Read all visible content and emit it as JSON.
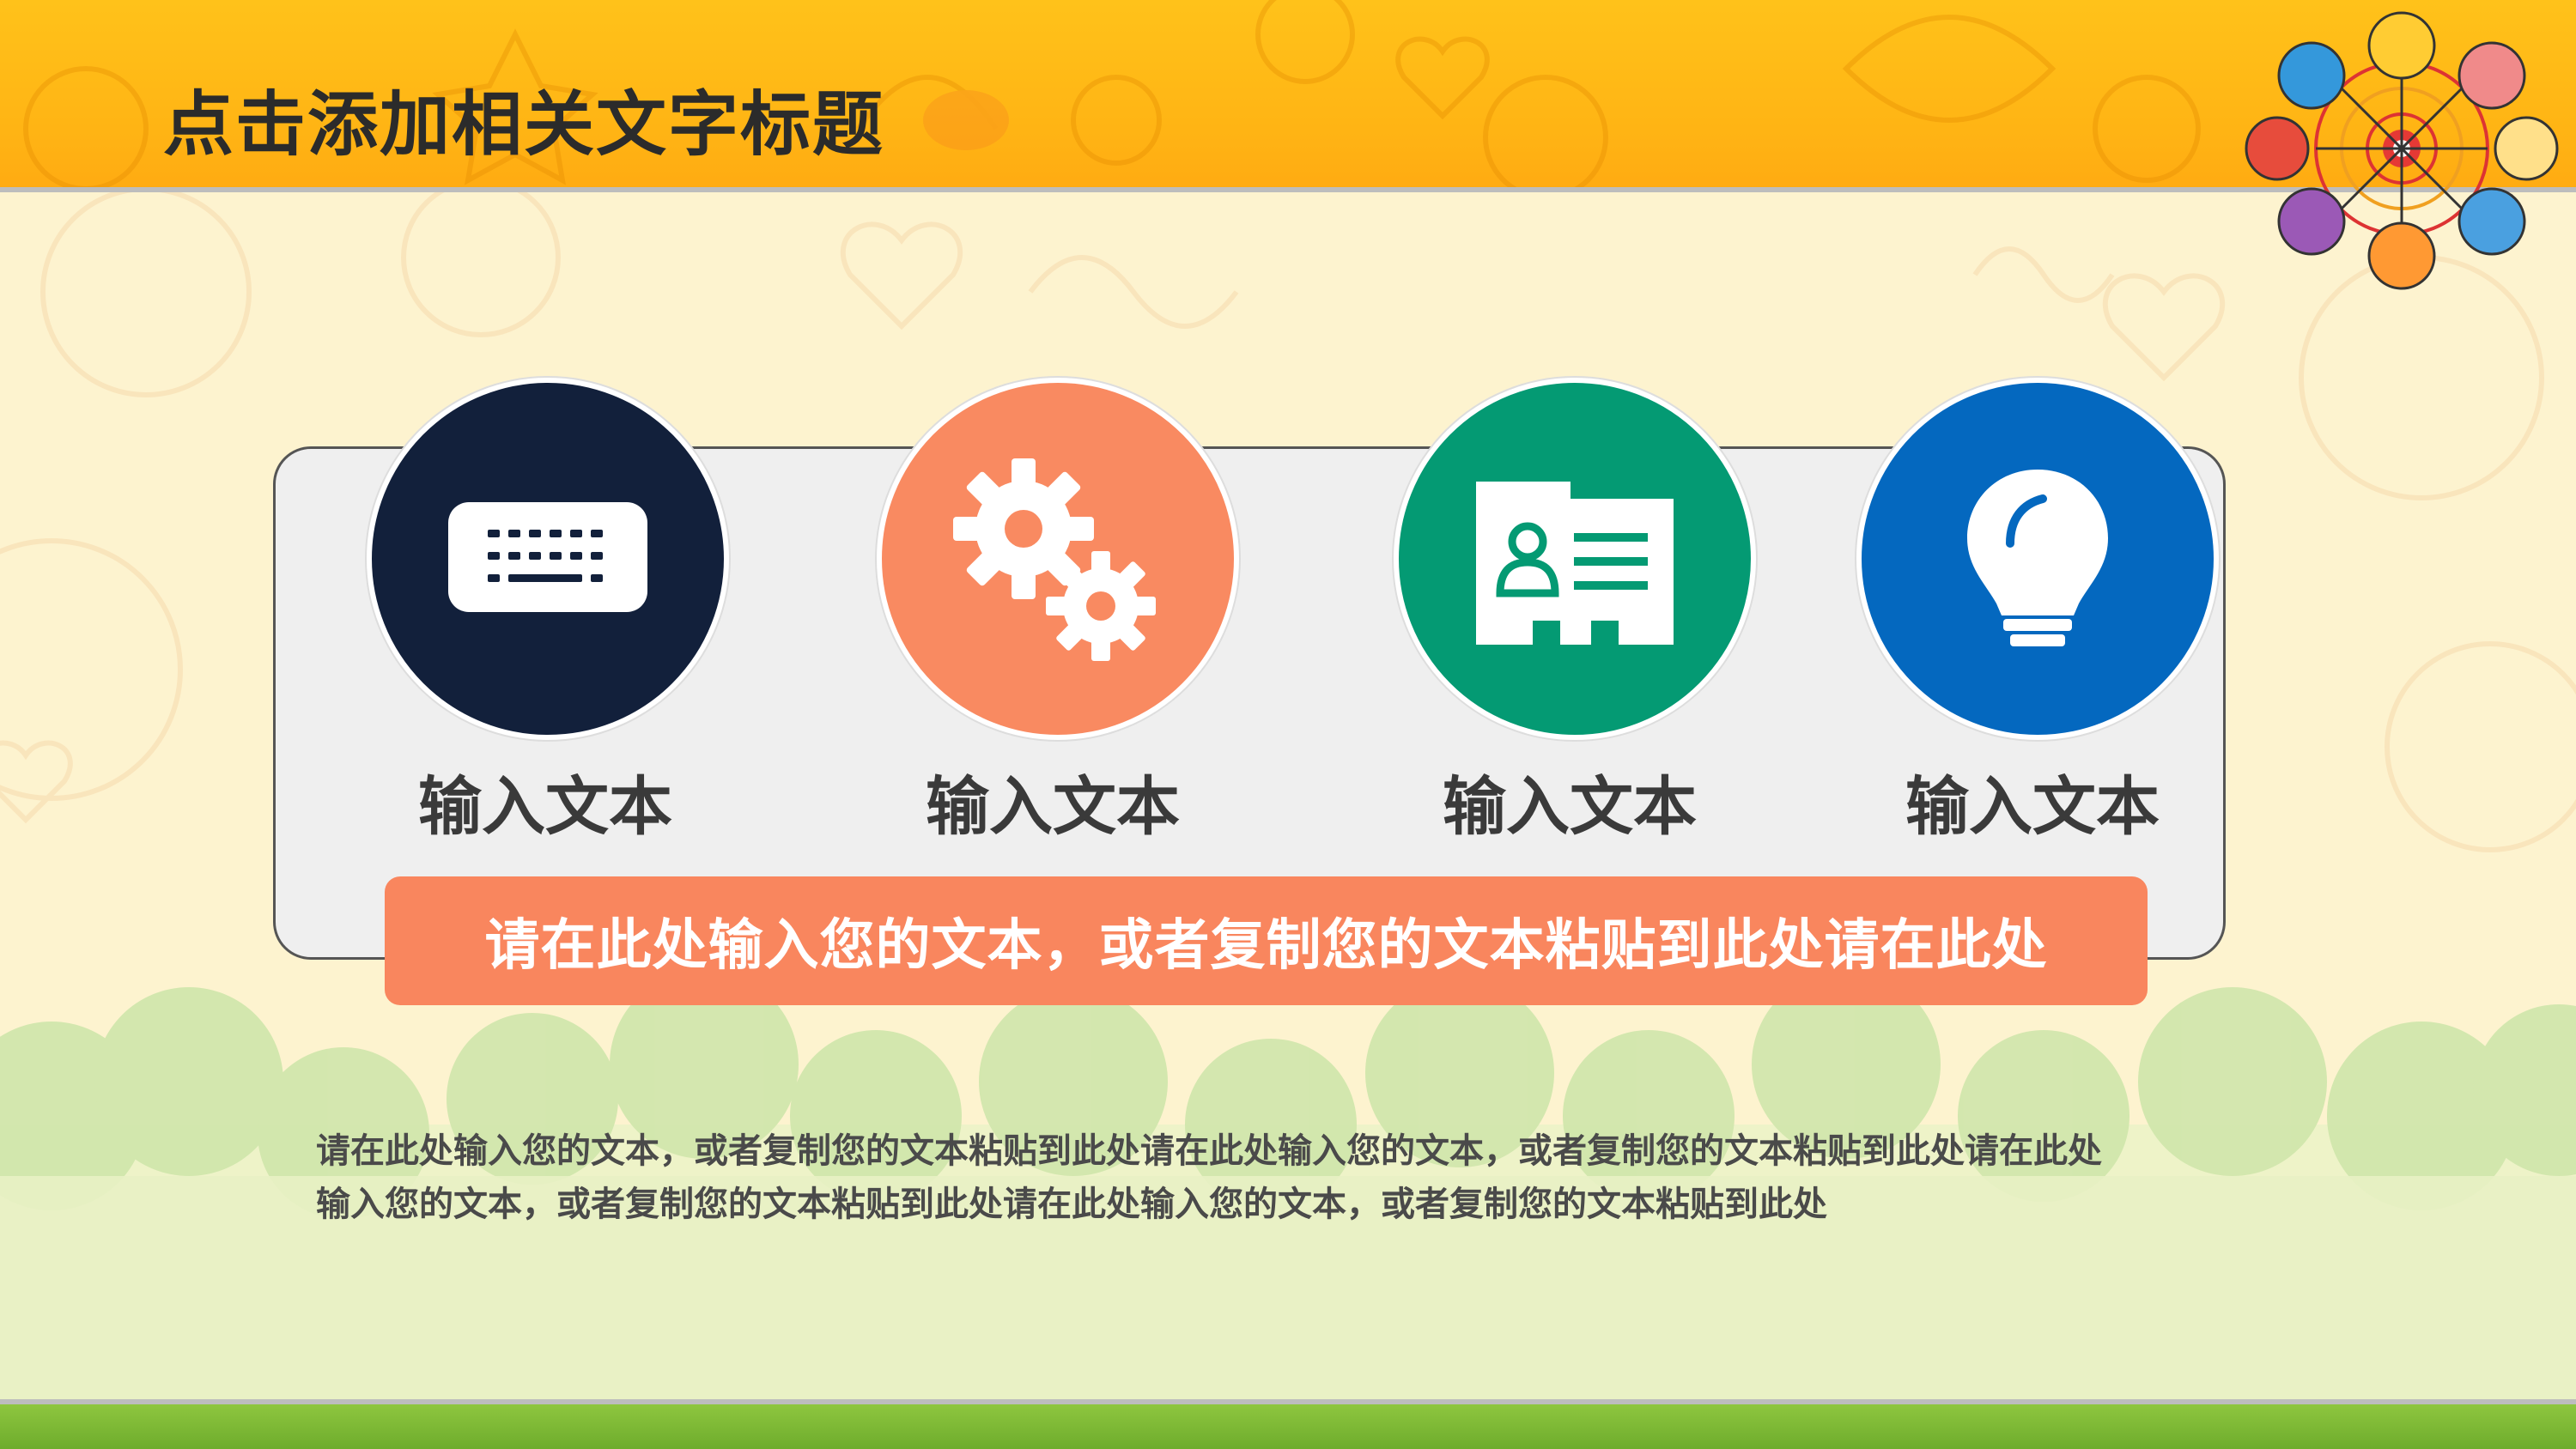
{
  "slide": {
    "title": "点击添加相关文字标题"
  },
  "features": [
    {
      "label": "输入文本",
      "icon": "keyboard-icon",
      "color": "#12203b"
    },
    {
      "label": "输入文本",
      "icon": "gears-icon",
      "color": "#f98a61"
    },
    {
      "label": "输入文本",
      "icon": "id-card-icon",
      "color": "#049a73"
    },
    {
      "label": "输入文本",
      "icon": "lightbulb-icon",
      "color": "#0468bf"
    }
  ],
  "banner": {
    "text": "请在此处输入您的文本，或者复制您的文本粘贴到此处请在此处"
  },
  "paragraph": {
    "line1": "请在此处输入您的文本，或者复制您的文本粘贴到此处请在此处输入您的文本，或者复制您的文本粘贴到此处请在此处",
    "line2": "输入您的文本，或者复制您的文本粘贴到此处请在此处输入您的文本，或者复制您的文本粘贴到此处"
  },
  "colors": {
    "header": "#ffb414",
    "accent": "#f98a61",
    "background": "#fdf3cf",
    "grass": "#8ec63f"
  }
}
